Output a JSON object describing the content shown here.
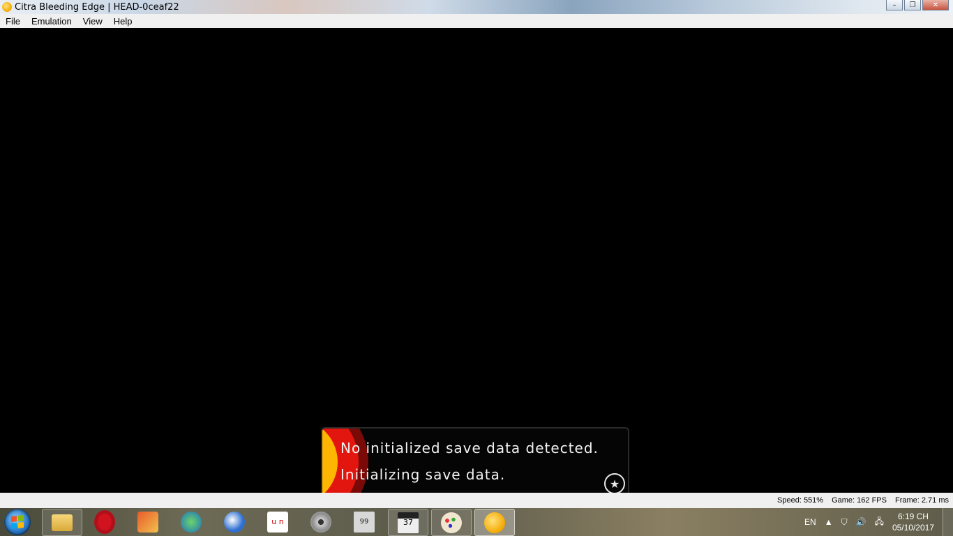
{
  "window": {
    "title": "Citra Bleeding Edge | HEAD-0ceaf22",
    "controls": {
      "minimize": "–",
      "maximize": "❐",
      "close": "✕"
    }
  },
  "menu": {
    "items": [
      {
        "label": "File"
      },
      {
        "label": "Emulation"
      },
      {
        "label": "View"
      },
      {
        "label": "Help"
      }
    ]
  },
  "game_screen": {
    "dialog": {
      "line1": "No initialized save data detected.",
      "line2": "Initializing save data."
    }
  },
  "status": {
    "speed": "Speed: 551%",
    "game_fps": "Game: 162 FPS",
    "frame": "Frame: 2.71 ms"
  },
  "taskbar": {
    "apps": [
      {
        "name": "explorer",
        "icon": "folder-icon"
      },
      {
        "name": "opera",
        "icon": "opera-icon"
      },
      {
        "name": "ccleaner",
        "icon": "ccleaner-icon"
      },
      {
        "name": "internet-download-manager",
        "icon": "idm-icon"
      },
      {
        "name": "browser",
        "icon": "eagle-browser-icon"
      },
      {
        "name": "unikey",
        "icon": "unikey-icon"
      },
      {
        "name": "media-player",
        "icon": "disc-icon"
      },
      {
        "name": "monitor",
        "icon": "monitor-icon"
      },
      {
        "name": "video-editor",
        "icon": "clapper-icon"
      },
      {
        "name": "paint",
        "icon": "paint-palette-icon"
      },
      {
        "name": "citra",
        "icon": "citra-icon"
      }
    ],
    "tray": {
      "language": "EN",
      "time": "6:19 CH",
      "date": "05/10/2017"
    }
  },
  "colors": {
    "menubar": "#f0f0f0",
    "render_bg": "#000000",
    "dialog_band_red": "#e3160f",
    "dialog_band_yellow": "#ffb600"
  }
}
